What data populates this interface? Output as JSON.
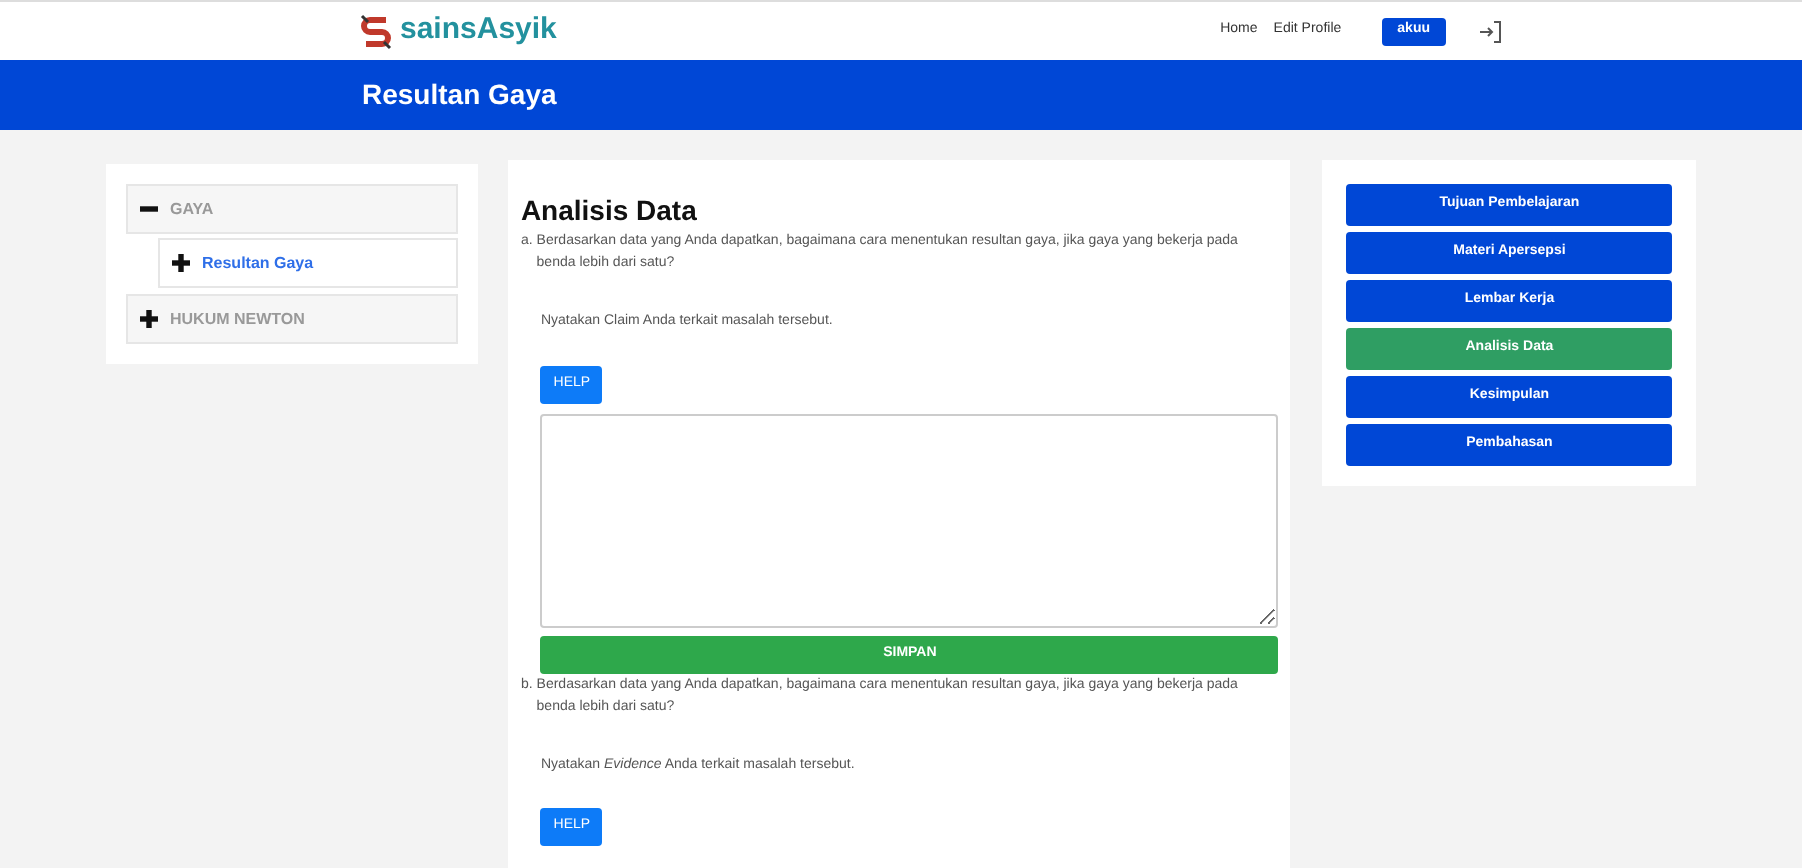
{
  "header": {
    "logo_text": "sainsAsyik",
    "nav": [
      "Home",
      "Edit Profile"
    ],
    "user_button": "akuu"
  },
  "banner": {
    "title": "Resultan Gaya"
  },
  "topics": [
    {
      "label": "GAYA",
      "expanded": true,
      "children": [
        {
          "label": "Resultan Gaya",
          "expanded": false
        }
      ]
    },
    {
      "label": "HUKUM NEWTON",
      "expanded": false
    }
  ],
  "content": {
    "title": "Analisis Data",
    "questions": [
      {
        "marker": "a.",
        "text": "Berdasarkan data yang Anda dapatkan, bagaimana cara menentukan resultan gaya, jika gaya yang bekerja pada benda lebih dari satu?",
        "prompt": "Nyatakan Claim Anda terkait masalah tersebut.",
        "help": "HELP",
        "answer_box": true,
        "save": "SIMPAN"
      },
      {
        "marker": "b.",
        "text": "Berdasarkan data yang Anda dapatkan, bagaimana cara menentukan resultan gaya, jika gaya yang bekerja pada benda lebih dari satu?",
        "prompt": "Nyatakan *Evidence* Anda terkait masalah tersebut.",
        "help": "HELP",
        "answer_box": false
      }
    ]
  },
  "sections": [
    {
      "label": "Tujuan Pembelajaran",
      "selected": false
    },
    {
      "label": "Materi Apersepsi",
      "selected": false
    },
    {
      "label": "Lembar Kerja",
      "selected": false
    },
    {
      "label": "Analisis Data",
      "selected": true
    },
    {
      "label": "Kesimpulan",
      "selected": false
    },
    {
      "label": "Pembahasan",
      "selected": false
    }
  ]
}
